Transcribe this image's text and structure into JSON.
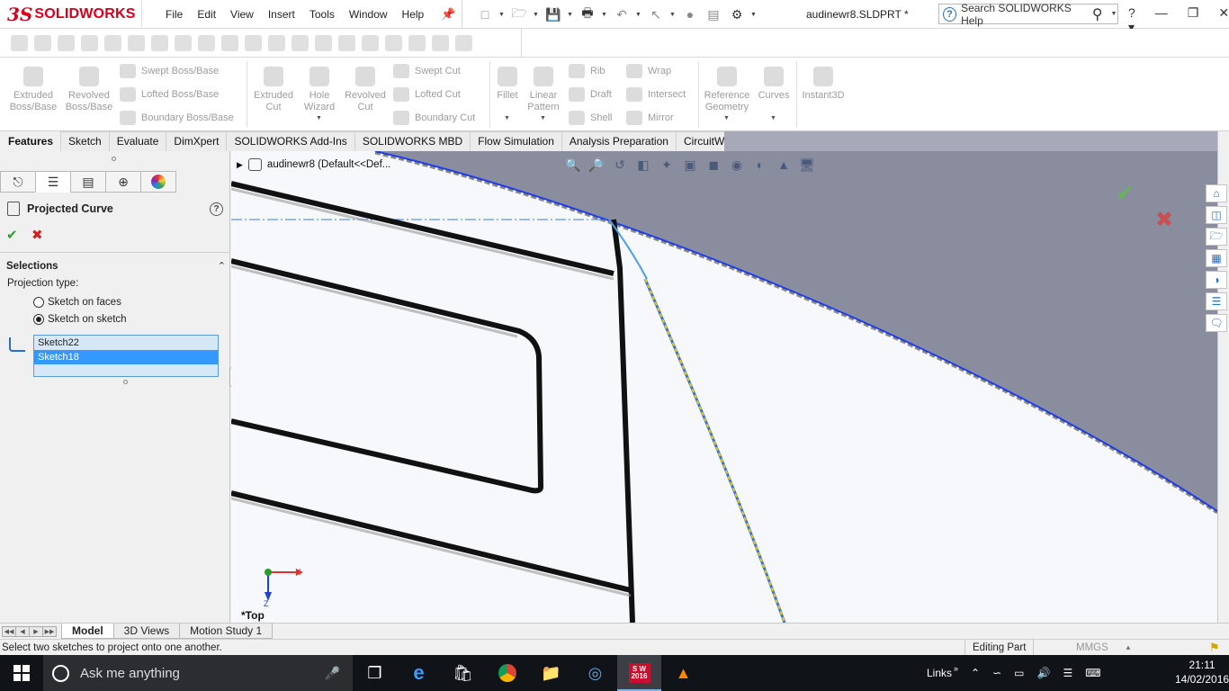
{
  "app": {
    "brand": "SOLIDWORKS",
    "document_title": "audinewr8.SLDPRT *"
  },
  "menu": [
    "File",
    "Edit",
    "View",
    "Insert",
    "Tools",
    "Window",
    "Help"
  ],
  "help_search": {
    "placeholder": "Search SOLIDWORKS Help"
  },
  "command_manager": {
    "extruded_boss": "Extruded Boss/Base",
    "revolved_boss": "Revolved Boss/Base",
    "swept_boss": "Swept Boss/Base",
    "lofted_boss": "Lofted Boss/Base",
    "boundary_boss": "Boundary Boss/Base",
    "extruded_cut": "Extruded Cut",
    "hole_wizard": "Hole Wizard",
    "revolved_cut": "Revolved Cut",
    "swept_cut": "Swept Cut",
    "lofted_cut": "Lofted Cut",
    "boundary_cut": "Boundary Cut",
    "fillet": "Fillet",
    "linear_pattern": "Linear Pattern",
    "rib": "Rib",
    "draft": "Draft",
    "shell": "Shell",
    "wrap": "Wrap",
    "intersect": "Intersect",
    "mirror": "Mirror",
    "reference_geometry": "Reference Geometry",
    "curves": "Curves",
    "instant3d": "Instant3D"
  },
  "tabs": [
    "Features",
    "Sketch",
    "Evaluate",
    "DimXpert",
    "SOLIDWORKS Add-Ins",
    "SOLIDWORKS MBD",
    "Flow Simulation",
    "Analysis Preparation",
    "CircuitWorks"
  ],
  "property_manager": {
    "title": "Projected Curve",
    "section": "Selections",
    "projection_label": "Projection type:",
    "option_faces": "Sketch on faces",
    "option_sketch": "Sketch on sketch",
    "selected_option": "Sketch on sketch",
    "selections": [
      "Sketch22",
      "Sketch18"
    ],
    "highlighted_selection": "Sketch18"
  },
  "graphics": {
    "tree_label": "audinewr8  (Default<<Def...",
    "view_name": "*Top",
    "triad_x": "X",
    "triad_z": "Z"
  },
  "model_tabs": [
    "Model",
    "3D Views",
    "Motion Study 1"
  ],
  "status": {
    "message": "Select two sketches to project onto one another.",
    "mode": "Editing Part",
    "units": "MMGS"
  },
  "taskbar": {
    "search_placeholder": "Ask me anything",
    "links_label": "Links",
    "time": "21:11",
    "date": "14/02/2016",
    "sw_badge": "S W 2016"
  },
  "colors": {
    "brand_red": "#d6001c",
    "selection_blue": "#3399ff",
    "surface_gray": "#8a8d9e",
    "edge_blue": "#1f3fff",
    "projected_yellow": "#e8d000",
    "preview_lightblue": "#4a9fe8"
  }
}
